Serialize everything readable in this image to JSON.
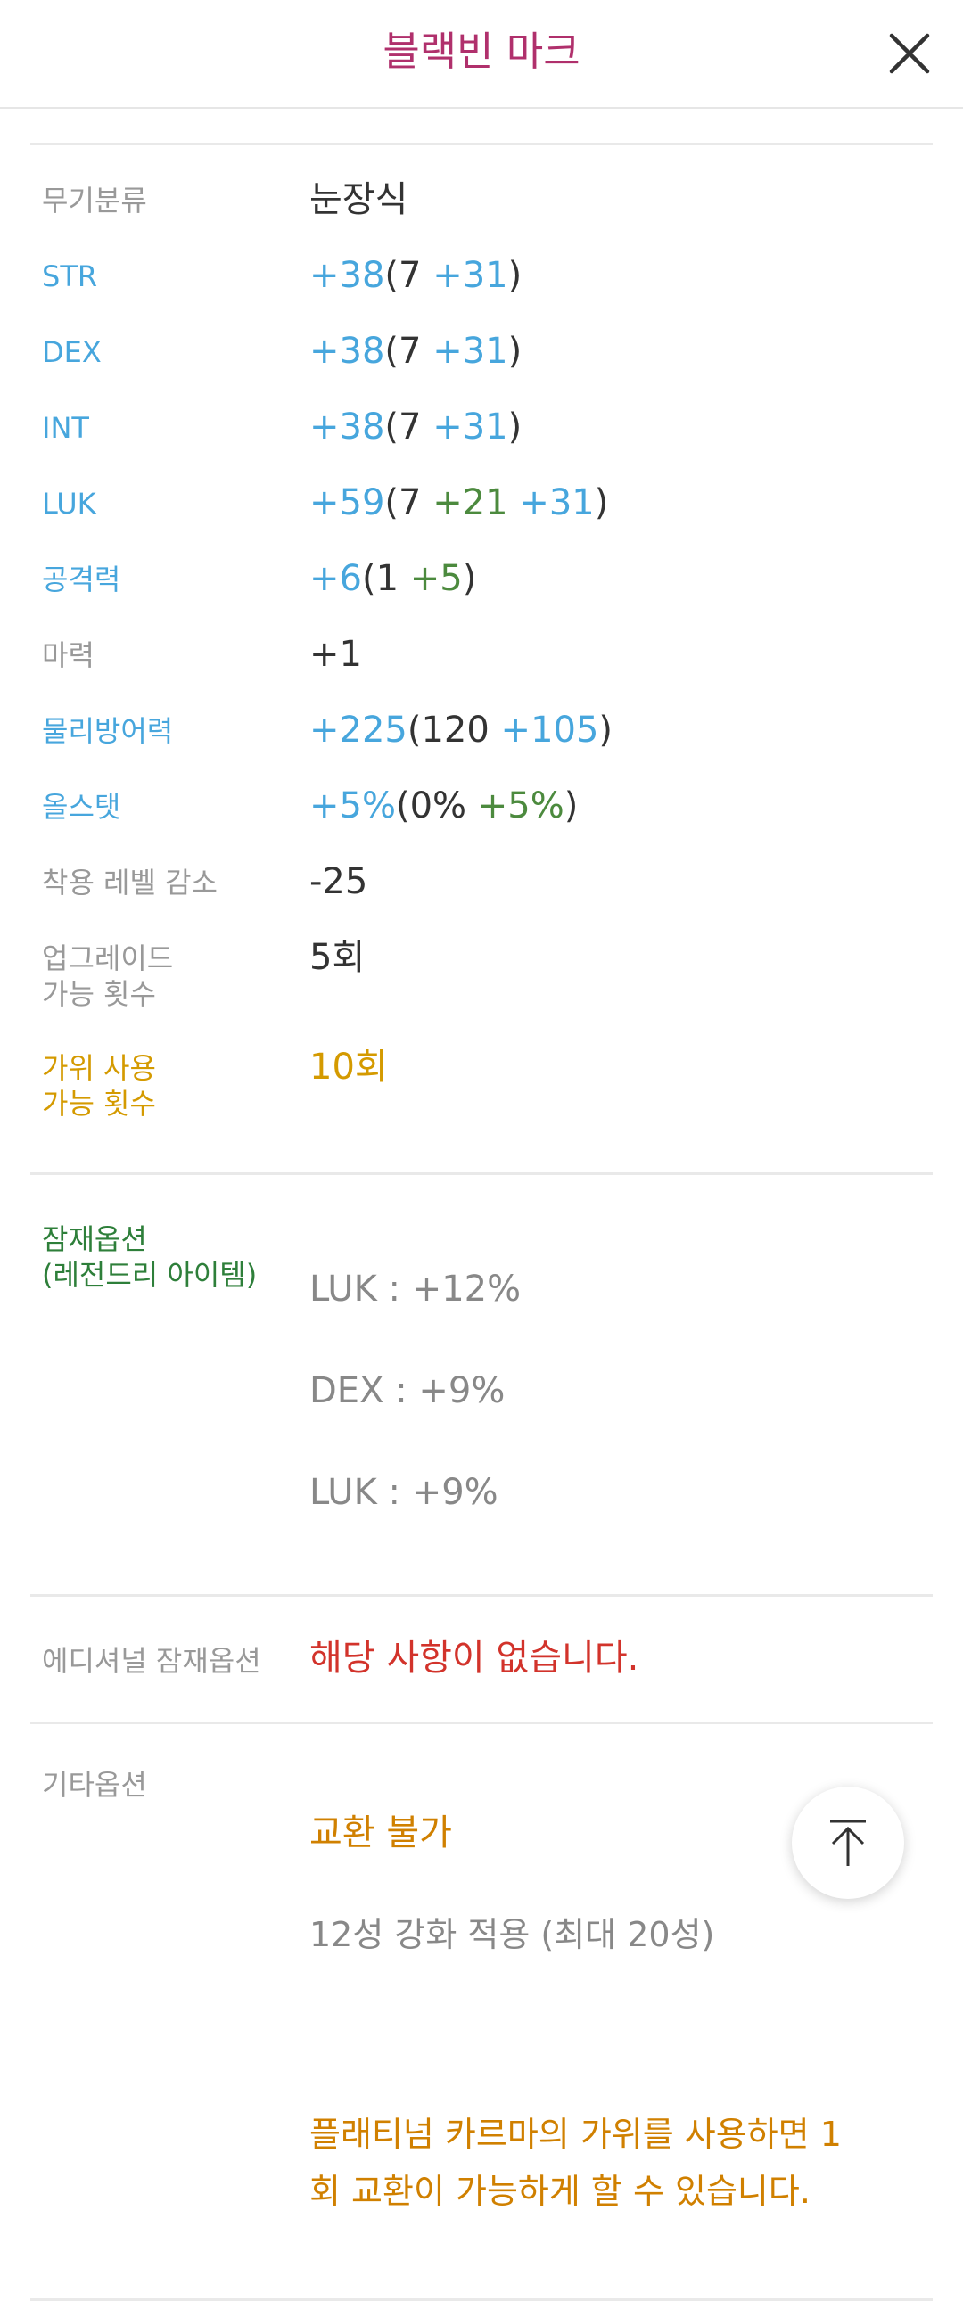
{
  "header": {
    "title": "블랙빈 마크",
    "close_icon": "close-icon"
  },
  "stats": [
    {
      "label": "무기분류",
      "label_color": "gray",
      "parts": [
        {
          "t": "눈장식",
          "c": "default"
        }
      ]
    },
    {
      "label": "STR",
      "label_color": "blue",
      "parts": [
        {
          "t": "+38",
          "c": "blue"
        },
        {
          "t": "(7 ",
          "c": "default"
        },
        {
          "t": "+31",
          "c": "blue"
        },
        {
          "t": ")",
          "c": "default"
        }
      ]
    },
    {
      "label": "DEX",
      "label_color": "blue",
      "parts": [
        {
          "t": "+38",
          "c": "blue"
        },
        {
          "t": "(7 ",
          "c": "default"
        },
        {
          "t": "+31",
          "c": "blue"
        },
        {
          "t": ")",
          "c": "default"
        }
      ]
    },
    {
      "label": "INT",
      "label_color": "blue",
      "parts": [
        {
          "t": "+38",
          "c": "blue"
        },
        {
          "t": "(7 ",
          "c": "default"
        },
        {
          "t": "+31",
          "c": "blue"
        },
        {
          "t": ")",
          "c": "default"
        }
      ]
    },
    {
      "label": "LUK",
      "label_color": "blue",
      "parts": [
        {
          "t": "+59",
          "c": "blue"
        },
        {
          "t": "(7 ",
          "c": "default"
        },
        {
          "t": "+21",
          "c": "green"
        },
        {
          "t": " ",
          "c": "default"
        },
        {
          "t": "+31",
          "c": "blue"
        },
        {
          "t": ")",
          "c": "default"
        }
      ]
    },
    {
      "label": "공격력",
      "label_color": "blue",
      "parts": [
        {
          "t": "+6",
          "c": "blue"
        },
        {
          "t": "(1 ",
          "c": "default"
        },
        {
          "t": "+5",
          "c": "green"
        },
        {
          "t": ")",
          "c": "default"
        }
      ]
    },
    {
      "label": "마력",
      "label_color": "gray",
      "parts": [
        {
          "t": "+1",
          "c": "default"
        }
      ]
    },
    {
      "label": "물리방어력",
      "label_color": "blue",
      "parts": [
        {
          "t": "+225",
          "c": "blue"
        },
        {
          "t": "(120 ",
          "c": "default"
        },
        {
          "t": "+105",
          "c": "blue"
        },
        {
          "t": ")",
          "c": "default"
        }
      ]
    },
    {
      "label": "올스탯",
      "label_color": "blue",
      "parts": [
        {
          "t": "+5%",
          "c": "blue"
        },
        {
          "t": "(0% ",
          "c": "default"
        },
        {
          "t": "+5%",
          "c": "green"
        },
        {
          "t": ")",
          "c": "default"
        }
      ]
    },
    {
      "label": "착용 레벨 감소",
      "label_color": "gray",
      "parts": [
        {
          "t": "-25",
          "c": "default"
        }
      ]
    },
    {
      "label": "업그레이드\n가능 횟수",
      "label_color": "gray",
      "multi": true,
      "parts": [
        {
          "t": "5회",
          "c": "default"
        }
      ]
    },
    {
      "label": "가위 사용\n가능 횟수",
      "label_color": "gold",
      "multi": true,
      "parts": [
        {
          "t": "10회",
          "c": "gold"
        }
      ]
    }
  ],
  "potential": {
    "label": "잠재옵션\n(레전드리 아이템)",
    "lines": [
      "LUK : +12%",
      "DEX : +9%",
      "LUK : +9%"
    ]
  },
  "additional": {
    "label": "에디셔널 잠재옵션",
    "value": "해당 사항이 없습니다."
  },
  "etc": {
    "label": "기타옵션",
    "trade": "교환 불가",
    "star": "12성 강화 적용 (최대 20성)",
    "karma": "플래티넘 카르마의 가위를 사용하면 1\n회 교환이 가능하게 할 수 있습니다."
  },
  "scroll_top_icon": "arrow-up-icon",
  "colors": {
    "title": "#b0306c",
    "blue": "#47a6dd",
    "green": "#4c8a3e",
    "gold": "#d49a00",
    "orange": "#d08000",
    "red": "#d2332b",
    "potential_label": "#2e7f3a",
    "gray": "#999999"
  }
}
